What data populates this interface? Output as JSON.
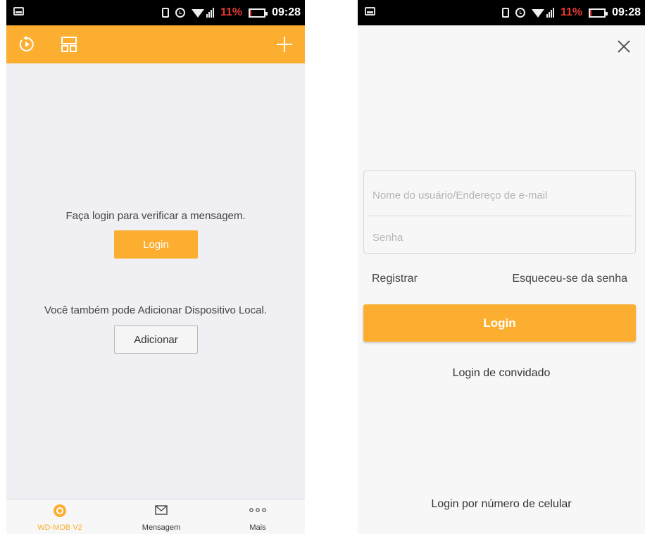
{
  "colors": {
    "accent": "#fbae30",
    "statusbar": "#000000",
    "battery_low": "#e53935"
  },
  "statusbar": {
    "battery_pct": "11%",
    "time": "09:28"
  },
  "left": {
    "toolbar": {
      "icons": [
        "playback-icon",
        "layout-icon",
        "add-icon"
      ]
    },
    "login_prompt": "Faça login para verificar a mensagem.",
    "login_button": "Login",
    "add_prompt": "Você também pode Adicionar Dispositivo Local.",
    "add_button": "Adicionar",
    "tabs": [
      {
        "label": "WD-MOB V2",
        "icon": "camera-icon",
        "active": true
      },
      {
        "label": "Mensagem",
        "icon": "envelope-icon",
        "active": false
      },
      {
        "label": "Mais",
        "icon": "more-dots-icon",
        "active": false
      }
    ]
  },
  "right": {
    "close_icon": "close-icon",
    "username_placeholder": "Nome do usuário/Endereço de e-mail",
    "password_placeholder": "Senha",
    "register_link": "Registrar",
    "forgot_link": "Esqueceu-se da senha",
    "login_button": "Login",
    "guest_login": "Login de convidado",
    "phone_login": "Login por número de celular"
  }
}
